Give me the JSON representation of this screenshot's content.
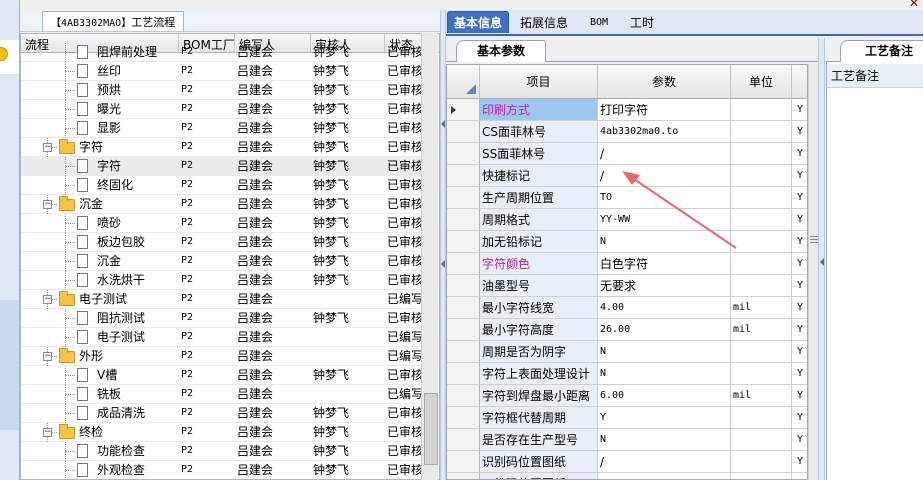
{
  "tree_panel": {
    "title_code": "【4AB3302MAO】",
    "title": "工艺流程",
    "columns": [
      "流程",
      "BOM工厂",
      "编写人",
      "审核人",
      "状态"
    ],
    "rows": [
      {
        "name": "阻焊前处理",
        "level": 2,
        "type": "leaf",
        "bom": "P2",
        "writer": "吕建会",
        "reviewer": "钟梦飞",
        "status": "已审核"
      },
      {
        "name": "丝印",
        "level": 2,
        "type": "leaf",
        "bom": "P2",
        "writer": "吕建会",
        "reviewer": "钟梦飞",
        "status": "已审核"
      },
      {
        "name": "预烘",
        "level": 2,
        "type": "leaf",
        "bom": "P2",
        "writer": "吕建会",
        "reviewer": "钟梦飞",
        "status": "已审核"
      },
      {
        "name": "曝光",
        "level": 2,
        "type": "leaf",
        "bom": "P2",
        "writer": "吕建会",
        "reviewer": "钟梦飞",
        "status": "已审核"
      },
      {
        "name": "显影",
        "level": 2,
        "type": "leaf",
        "bom": "P2",
        "writer": "吕建会",
        "reviewer": "钟梦飞",
        "status": "已审核"
      },
      {
        "name": "字符",
        "level": 1,
        "type": "folder",
        "bom": "P2",
        "writer": "吕建会",
        "reviewer": "钟梦飞",
        "status": "已审核"
      },
      {
        "name": "字符",
        "level": 2,
        "type": "leaf",
        "bom": "P2",
        "writer": "吕建会",
        "reviewer": "钟梦飞",
        "status": "已审核",
        "selected": true
      },
      {
        "name": "终固化",
        "level": 2,
        "type": "leaf",
        "bom": "P2",
        "writer": "吕建会",
        "reviewer": "钟梦飞",
        "status": "已审核"
      },
      {
        "name": "沉金",
        "level": 1,
        "type": "folder",
        "bom": "P2",
        "writer": "吕建会",
        "reviewer": "钟梦飞",
        "status": "已审核"
      },
      {
        "name": "喷砂",
        "level": 2,
        "type": "leaf",
        "bom": "P2",
        "writer": "吕建会",
        "reviewer": "钟梦飞",
        "status": "已审核"
      },
      {
        "name": "板边包胶",
        "level": 2,
        "type": "leaf",
        "bom": "P2",
        "writer": "吕建会",
        "reviewer": "钟梦飞",
        "status": "已审核"
      },
      {
        "name": "沉金",
        "level": 2,
        "type": "leaf",
        "bom": "P2",
        "writer": "吕建会",
        "reviewer": "钟梦飞",
        "status": "已审核"
      },
      {
        "name": "水洗烘干",
        "level": 2,
        "type": "leaf",
        "bom": "P2",
        "writer": "吕建会",
        "reviewer": "钟梦飞",
        "status": "已审核"
      },
      {
        "name": "电子测试",
        "level": 1,
        "type": "folder",
        "bom": "P2",
        "writer": "吕建会",
        "reviewer": "",
        "status": "已编写"
      },
      {
        "name": "阻抗测试",
        "level": 2,
        "type": "leaf",
        "bom": "P2",
        "writer": "吕建会",
        "reviewer": "钟梦飞",
        "status": "已审核"
      },
      {
        "name": "电子测试",
        "level": 2,
        "type": "leaf",
        "bom": "P2",
        "writer": "吕建会",
        "reviewer": "",
        "status": "已编写"
      },
      {
        "name": "外形",
        "level": 1,
        "type": "folder",
        "bom": "P2",
        "writer": "吕建会",
        "reviewer": "",
        "status": "已编写"
      },
      {
        "name": "V槽",
        "level": 2,
        "type": "leaf",
        "bom": "P2",
        "writer": "吕建会",
        "reviewer": "钟梦飞",
        "status": "已审核"
      },
      {
        "name": "铣板",
        "level": 2,
        "type": "leaf",
        "bom": "P2",
        "writer": "吕建会",
        "reviewer": "",
        "status": "已编写"
      },
      {
        "name": "成品清洗",
        "level": 2,
        "type": "leaf",
        "bom": "P2",
        "writer": "吕建会",
        "reviewer": "钟梦飞",
        "status": "已审核"
      },
      {
        "name": "终检",
        "level": 1,
        "type": "folder",
        "bom": "P2",
        "writer": "吕建会",
        "reviewer": "钟梦飞",
        "status": "已审核"
      },
      {
        "name": "功能检查",
        "level": 2,
        "type": "leaf",
        "bom": "P2",
        "writer": "吕建会",
        "reviewer": "钟梦飞",
        "status": "已审核"
      },
      {
        "name": "外观检查",
        "level": 2,
        "type": "leaf",
        "bom": "P2",
        "writer": "吕建会",
        "reviewer": "钟梦飞",
        "status": "已审核"
      }
    ]
  },
  "top_tabs": [
    "基本信息",
    "拓展信息",
    "BOM",
    "工时"
  ],
  "sub_tab": "基本参数",
  "param_grid": {
    "columns": [
      "项目",
      "参数",
      "单位"
    ],
    "rows": [
      {
        "name": "印刷方式",
        "value": "打印字符",
        "unit": "",
        "flag": "Y",
        "pink": true,
        "current": true
      },
      {
        "name": "CS面菲林号",
        "value": "4ab3302ma0.to",
        "unit": "",
        "flag": "Y",
        "mono": true
      },
      {
        "name": "SS面菲林号",
        "value": "/",
        "unit": "",
        "flag": "Y"
      },
      {
        "name": "快捷标记",
        "value": "/",
        "unit": "",
        "flag": "Y"
      },
      {
        "name": "生产周期位置",
        "value": "TO",
        "unit": "",
        "flag": "Y",
        "mono": true
      },
      {
        "name": "周期格式",
        "value": "YY-WW",
        "unit": "",
        "flag": "Y",
        "mono": true
      },
      {
        "name": "加无铅标记",
        "value": "N",
        "unit": "",
        "flag": "Y",
        "mono": true
      },
      {
        "name": "字符颜色",
        "value": "白色字符",
        "unit": "",
        "flag": "Y",
        "pink": true
      },
      {
        "name": "油墨型号",
        "value": "无要求",
        "unit": "",
        "flag": "Y"
      },
      {
        "name": "最小字符线宽",
        "value": "4.00",
        "unit": "mil",
        "flag": "Y",
        "mono": true
      },
      {
        "name": "最小字符高度",
        "value": "26.00",
        "unit": "mil",
        "flag": "Y",
        "mono": true
      },
      {
        "name": "周期是否为阴字",
        "value": "N",
        "unit": "",
        "flag": "Y",
        "mono": true
      },
      {
        "name": "字符上表面处理设计",
        "value": "N",
        "unit": "",
        "flag": "Y",
        "mono": true
      },
      {
        "name": "字符到焊盘最小距离",
        "value": "6.00",
        "unit": "mil",
        "flag": "Y",
        "mono": true
      },
      {
        "name": "字符框代替周期",
        "value": "Y",
        "unit": "",
        "flag": "Y",
        "mono": true
      },
      {
        "name": "是否存在生产型号",
        "value": "N",
        "unit": "",
        "flag": "Y",
        "mono": true
      },
      {
        "name": "识别码位置图纸",
        "value": "/",
        "unit": "",
        "flag": "Y"
      },
      {
        "name": "二维码位置图纸",
        "value": "/",
        "unit": "",
        "flag": "Y"
      }
    ]
  },
  "note_panel": {
    "tab": "工艺备注",
    "label": "工艺备注"
  },
  "colors": {
    "accent": "#3f6fc1",
    "highlight": "#9cc7ef",
    "pink": "#c020b0",
    "arrow": "#e36b6b"
  }
}
